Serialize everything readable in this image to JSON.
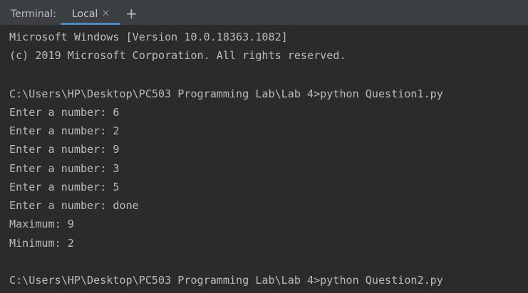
{
  "tool_window": {
    "title": "Terminal:",
    "tabs": [
      {
        "label": "Local",
        "active": true,
        "close_icon": "close-icon"
      }
    ],
    "add_icon": "plus-icon"
  },
  "terminal": {
    "lines": [
      "Microsoft Windows [Version 10.0.18363.1082]",
      "(c) 2019 Microsoft Corporation. All rights reserved.",
      "",
      "C:\\Users\\HP\\Desktop\\PC503 Programming Lab\\Lab 4>python Question1.py",
      "Enter a number: 6",
      "Enter a number: 2",
      "Enter a number: 9",
      "Enter a number: 3",
      "Enter a number: 5",
      "Enter a number: done",
      "Maximum: 9",
      "Minimum: 2",
      "",
      "C:\\Users\\HP\\Desktop\\PC503 Programming Lab\\Lab 4>python Question2.py"
    ]
  },
  "colors": {
    "background": "#2b2b2b",
    "tab_bar": "#3c3f41",
    "text": "#bbbbbb",
    "active_tab_underline": "#4a88c7"
  }
}
